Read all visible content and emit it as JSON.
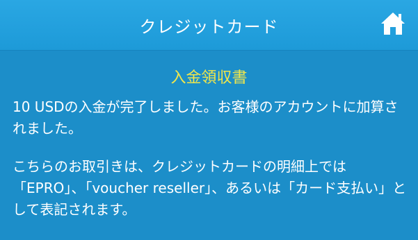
{
  "header": {
    "title": "クレジットカード",
    "home_icon": "home-icon"
  },
  "main": {
    "receipt_title": "入金領収書",
    "paragraph1": "10 USDの入金が完了しました。お客様のアカウントに加算されました。",
    "paragraph2": "こちらのお取引きは、クレジットカードの明細上では「EPRO」、「voucher reseller」、あるいは「カード支払い」として表記されます。"
  },
  "colors": {
    "header_bg": "#1d9ad8",
    "content_bg": "#1c8ec9",
    "title_accent": "#f2e74a",
    "text": "#ffffff"
  }
}
